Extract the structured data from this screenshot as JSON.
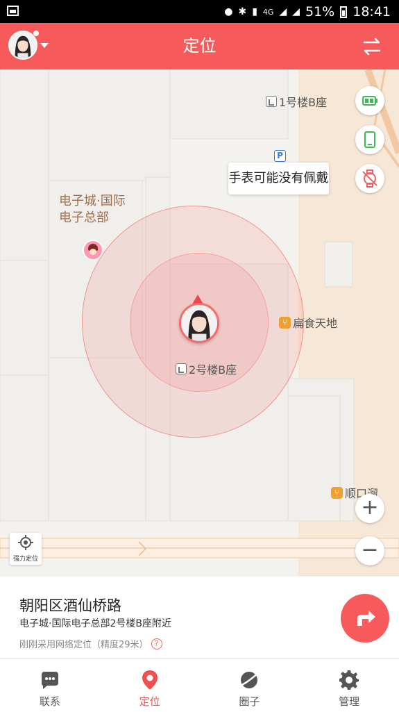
{
  "status_bar": {
    "battery_percent": "51%",
    "time": "18:41",
    "network": "4G"
  },
  "app_bar": {
    "title": "定位",
    "avatar_icon": "girl-avatar",
    "switch_icon": "switch-arrows-icon"
  },
  "map": {
    "pois": {
      "building_1b": "1号楼B座",
      "building_2b": "2号楼B座",
      "food_1": "扁食天地",
      "food_2": "顺口溜"
    },
    "area_label_line1": "电子城·国际",
    "area_label_line2": "电子总部",
    "parking_label": "P",
    "tooltip": "手表可能没有佩戴",
    "locate_label": "强力定位",
    "zoom_in": "+",
    "zoom_out": "−",
    "colors": {
      "accent": "#f65a5a",
      "battery_green": "#3cba54"
    }
  },
  "info": {
    "address": "朝阳区酒仙桥路",
    "detail": "电子城·国际电子总部2号楼B座附近",
    "accuracy": "刚刚采用网络定位（精度29米）",
    "help": "?"
  },
  "tabs": [
    {
      "label": "联系",
      "icon": "chat-bubble-icon",
      "active": false
    },
    {
      "label": "定位",
      "icon": "location-pin-icon",
      "active": true
    },
    {
      "label": "圈子",
      "icon": "planet-icon",
      "active": false
    },
    {
      "label": "管理",
      "icon": "gear-icon",
      "active": false
    }
  ]
}
